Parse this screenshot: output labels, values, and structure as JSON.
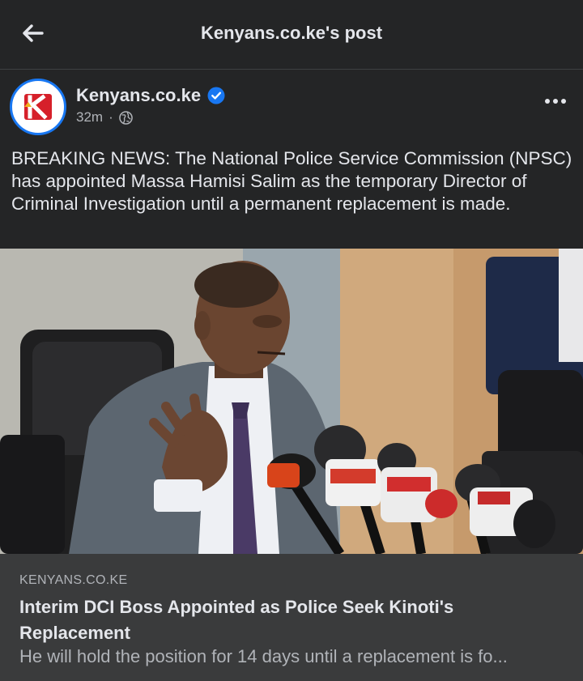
{
  "header": {
    "title": "Kenyans.co.ke's post"
  },
  "post": {
    "author": "Kenyans.co.ke",
    "time": "32m",
    "separator": "·",
    "text": "BREAKING NEWS: The National Police Service Commission (NPSC) has appointed Massa Hamisi Salim as the temporary Director of Criminal Investigation until a permanent replacement is made."
  },
  "link": {
    "domain": "KENYANS.CO.KE",
    "title": "Interim DCI Boss Appointed as Police Seek Kinoti's Replacement",
    "description": "He will hold the position for 14 days until a replacement is fo..."
  },
  "colors": {
    "background": "#242526",
    "accent": "#1877f2",
    "card": "#3a3b3c",
    "muted": "#b0b3b8",
    "brand_red": "#d6202a"
  },
  "icons": [
    "back-arrow-icon",
    "verified-badge-icon",
    "globe-icon",
    "more-options-icon",
    "kenyans-logo"
  ]
}
